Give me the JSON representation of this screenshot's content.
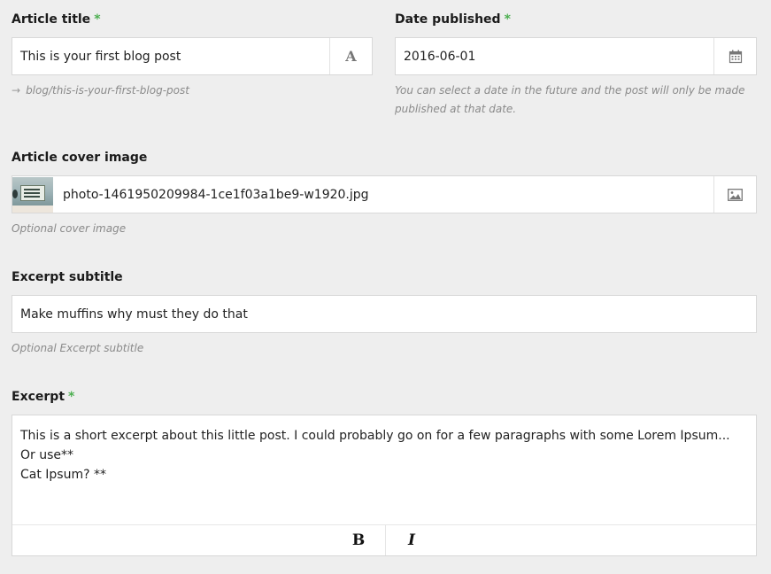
{
  "article_title": {
    "label": "Article title",
    "required_marker": "*",
    "value": "This is your first blog post",
    "addon_icon": "text-font-icon",
    "addon_glyph": "A",
    "slug_arrow": "→",
    "slug": "blog/this-is-your-first-blog-post"
  },
  "date_published": {
    "label": "Date published",
    "required_marker": "*",
    "value": "2016-06-01",
    "addon_icon": "calendar-icon",
    "help_line_1": "You can select a date in the future and the post will only be made",
    "help_line_2": "published at that date."
  },
  "cover_image": {
    "label": "Article cover image",
    "filename": "photo-1461950209984-1ce1f03a1be9-w1920.jpg",
    "addon_icon": "image-icon",
    "help": "Optional cover image"
  },
  "excerpt_subtitle": {
    "label": "Excerpt subtitle",
    "value": "Make muffins why must they do that",
    "help": "Optional Excerpt subtitle"
  },
  "excerpt": {
    "label": "Excerpt",
    "required_marker": "*",
    "line_1": "This is a short excerpt about this little post. I could probably go on for a few paragraphs with some Lorem Ipsum... Or use**",
    "line_2": "Cat Ipsum? **",
    "bold_label": "B",
    "italic_label": "I"
  },
  "colors": {
    "background": "#eeeeee",
    "required": "#4caf50",
    "help_text": "#8a8a8a",
    "border": "#d8d8d8"
  }
}
